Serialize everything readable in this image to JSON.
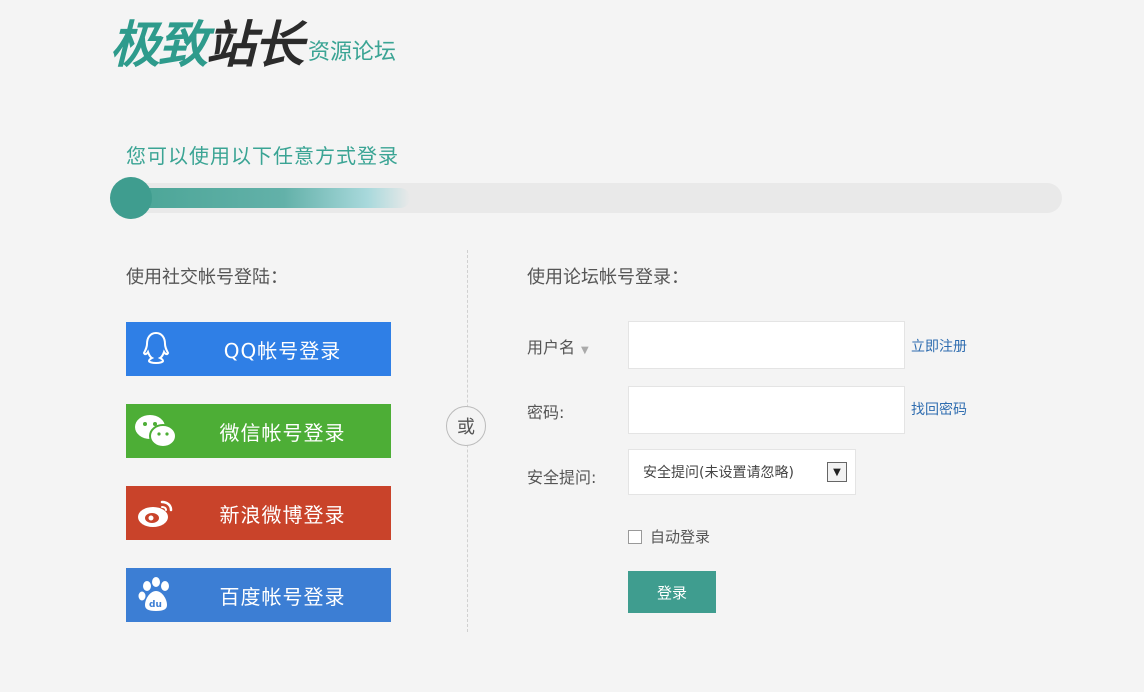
{
  "logo": {
    "brand_part1": "极致",
    "brand_part2": "站长",
    "sub": "资源论坛"
  },
  "headline": "您可以使用以下任意方式登录",
  "left": {
    "title": "使用社交帐号登陆：",
    "buttons": [
      {
        "label": "QQ帐号登录",
        "icon": "qq-icon",
        "color": "#2f7fe6"
      },
      {
        "label": "微信帐号登录",
        "icon": "wechat-icon",
        "color": "#4dae36"
      },
      {
        "label": "新浪微博登录",
        "icon": "weibo-icon",
        "color": "#c9432a"
      },
      {
        "label": "百度帐号登录",
        "icon": "baidu-icon",
        "color": "#3c7ed4"
      }
    ]
  },
  "or_label": "或",
  "right": {
    "title": "使用论坛帐号登录：",
    "username_label": "用户名",
    "register_link": "立即注册",
    "password_label": "密码:",
    "forgot_link": "找回密码",
    "security_label": "安全提问:",
    "security_select_value": "安全提问(未设置请忽略)",
    "auto_login_label": "自动登录",
    "submit_label": "登录"
  },
  "colors": {
    "accent": "#3f9d8f",
    "link": "#2f6db0",
    "background": "#f4f4f4"
  }
}
